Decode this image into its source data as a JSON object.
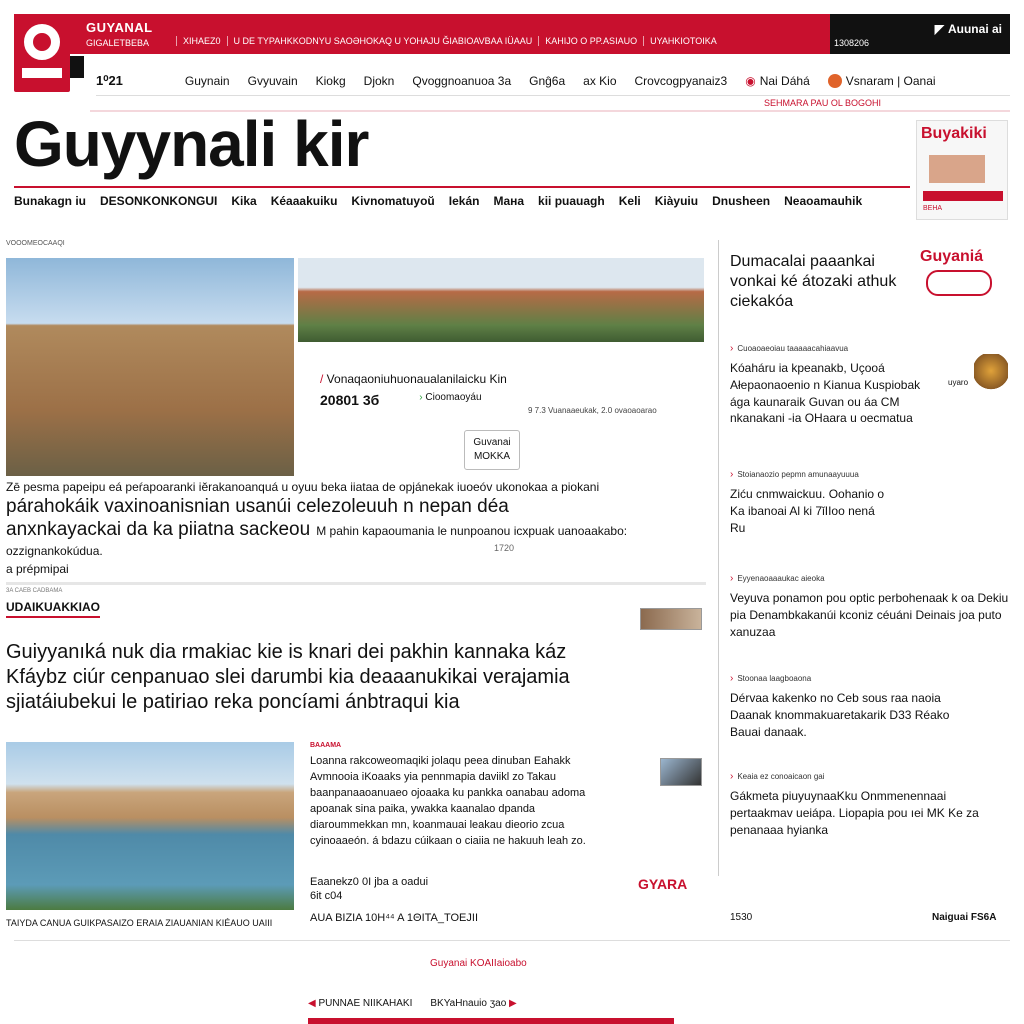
{
  "topbar": {
    "brand": "GUYANAL",
    "brand_sub": "GIGALETBEBA",
    "links": [
      "XIHAEZ0",
      "U DE TYPAHKKODNYU SAOƏHOKAQ U YOHAJU ĞIABIOAVBAA IÜAAU",
      "KAHIJO O PP.ASIAUO",
      "UYAHKIOTOIKA"
    ],
    "date": "1308206",
    "right_label": "Auunai ai"
  },
  "secnav": {
    "number": "1⁰21",
    "items": [
      "Guynain",
      "Gvyuvain",
      "Kiokg",
      "Djokn",
      "Qvoggnoanuoa 3a",
      "Gnĝ6a",
      "ax Kio",
      "Crovcogpyanaiz3"
    ],
    "pill_1": "Nai Dáhá",
    "pill_2": "Vsnaram | Oanai"
  },
  "tagline": "SEHMARA PAU OL BOGOHI",
  "masthead": "Guyynali kir",
  "ad_top": {
    "title": "Buyakiki",
    "sub": "BEHA"
  },
  "mainnav": [
    "Bunakagn iu",
    "DESONKONKONGUI",
    "Kika",
    "Kéaaakuiku",
    "Kivnomatuyoŭ",
    "Iekán",
    "Maнa",
    "kii puauagh",
    "Keli",
    "Kiàyuiu",
    "Dnusheen",
    "Neaoamauhik"
  ],
  "section_label": "VOOOMEOCAAQI",
  "feature": {
    "line1": "Vonaqaoniuhuonaualanilaicku Kin",
    "num": "20801 3б",
    "tag": "Cioomaoyáu",
    "meta": "9 7.3 Vuanaaeukak, 2.0 ovaoaoarao",
    "btn_line1": "Guvanai",
    "btn_line2": "MOKKA"
  },
  "lead": {
    "small": "Zē pesma papeipu eá peŕapoaranki iĕrakanoanquá u oyuu beka iiataa de opjánekak iuoeóv ukonokaa a piokani",
    "big_1": "párahokáik vaxinoanisnian usanúi celezoleuuh n nepan déa",
    "big_2": "anxnkayackai da ka piiatna sackeou",
    "inline": "M pahin kapaoumania le nunpoanou icxpuak uanoaakabo:",
    "tail1": "ozzignankokúdua.",
    "tail2": "a prépmipai",
    "time": "1720"
  },
  "sec2": {
    "tiny": "3A CAEB CADBAMA",
    "title": "UDAIKUAKKIAO",
    "headline_1": "Guiyyanıká nuk dia rmakiac kie is knari dei pakhin kannaka káz",
    "headline_2": "Kfáybz ciúr cenpanuao slei darumbi kia deaaanukikai verajamia",
    "headline_3": "sjiatáiubekui le patiriao reka poncíami ánbtraqui kia"
  },
  "story2": {
    "kicker": "BAAAMA",
    "body": "Loanna rakcoweomaqiki jolaqu peea dinuban Eahakk Avmnooia iKoaaks yia pennmapia daviikl zo Takau baanpanaaoanuaeo ojoaaka ku pankka oanabau adoma apoanak sina paika, ywakka kaanalao dpanda diaroummekkan mn, koanmauai leakau dieorio zcua cyinoaaeón. á bdazu cúikaan o ciaiia ne hakuuh leah zo.",
    "foot1": "Eaanekz0 0I jba a oadui",
    "foot2": "6it c04",
    "foot3": "AUA BIZIA 10H⁴⁴ A 1ΘITA_TOEJII",
    "logo": "GYARA"
  },
  "river_caption": "TAIYDA CANUA GUIKPASAIZO ERAIA ZIAUANIAN KIÉAUO UAIII",
  "sidebar": {
    "head": "Dumacalai paaankai vonkai ké átozaki athuk ciekakóa",
    "logo": "Guyaniá",
    "items": [
      {
        "kicker": "Cuoaoaeoiau taaaaacahiaavua",
        "body": "Kóaháru ia kpeanakb, Uçooá Ałepaonaoenio n Kianua Kuspiobak ága kaunaraik Guvan ou áa CM nkanakani -ia OHaara u oecmatua"
      },
      {
        "kicker": "Stoianaozio pepmn amunaayuuua",
        "body": "Ziću cnmwaickuu. Oohanio o Ka ibanoai Al ki 7ǐIIoo nená Ru"
      },
      {
        "kicker": "Eyyenaoaaaukac aieoka",
        "body": "Veyuva ponamon pou optic perbohenaak k oa Dekiu pia Denambkakanúi kconiz céuáni Deinais joa puto xanuzaa"
      },
      {
        "kicker": "Stoonaa laagboaona",
        "body": "Dérvaa kakenko no Ceb sous raa naoia Daanak knommakuaretakarik D33 Réako Bauai danaak."
      },
      {
        "kicker": "Keaia ez conoaicaon gai",
        "body": "Gákmeta piuyuynaaKku Onmmenennaai pertaakmav ueiápa. Liopapia pou ıei MK Ke za penanaaa hyianka"
      }
    ],
    "thumb_cap": "uyaro"
  },
  "footer": {
    "left": "1530",
    "right": "Naiguai FS6A",
    "logo": "Guyanai KOAIIaioabo",
    "nav_1": "PUNNAE NIIKAHAKI",
    "nav_2": "BKYaHnauio ʒao"
  }
}
